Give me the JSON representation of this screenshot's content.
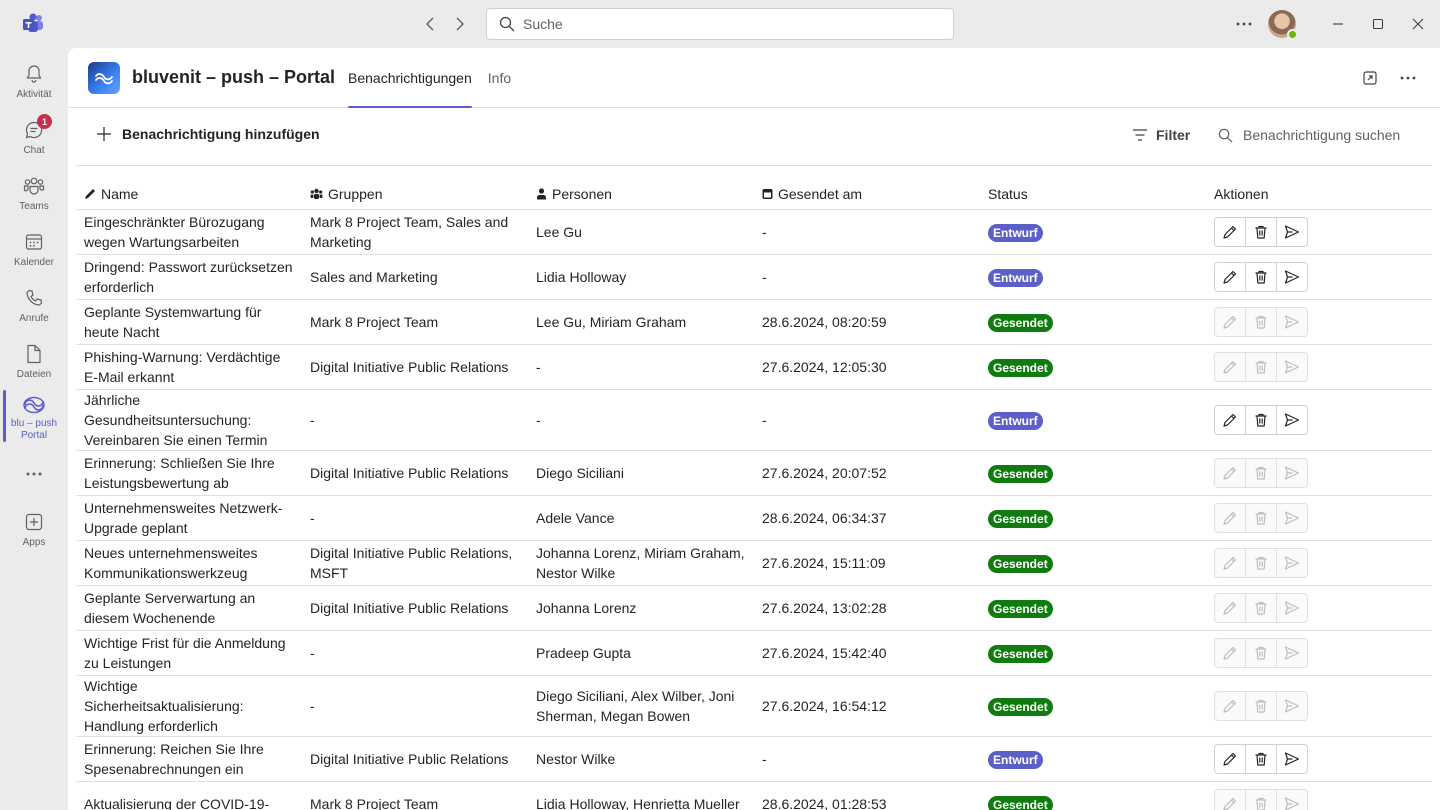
{
  "titlebar": {
    "search_placeholder": "Suche",
    "icons": [
      "teams-logo-icon",
      "back-arrow-icon",
      "forward-arrow-icon",
      "search-icon",
      "more-icon",
      "minimize-icon",
      "maximize-icon",
      "close-icon"
    ]
  },
  "rail": {
    "items": [
      {
        "label": "Aktivität",
        "icon": "bell-icon"
      },
      {
        "label": "Chat",
        "icon": "chat-icon",
        "badge": "1"
      },
      {
        "label": "Teams",
        "icon": "teams-icon"
      },
      {
        "label": "Kalender",
        "icon": "calendar-icon"
      },
      {
        "label": "Anrufe",
        "icon": "phone-icon"
      },
      {
        "label": "Dateien",
        "icon": "file-icon"
      },
      {
        "label": "blu – push Portal",
        "icon": "bluvenit-icon",
        "active": true
      },
      {
        "label": "Apps",
        "icon": "apps-icon"
      }
    ]
  },
  "app": {
    "title": "bluvenit – push – Portal",
    "tabs": [
      {
        "label": "Benachrichtigungen",
        "active": true
      },
      {
        "label": "Info",
        "active": false
      }
    ]
  },
  "toolbar": {
    "add_label": "Benachrichtigung hinzufügen",
    "filter_label": "Filter",
    "search_placeholder": "Benachrichtigung suchen"
  },
  "table": {
    "headers": {
      "name": "Name",
      "groups": "Gruppen",
      "persons": "Personen",
      "sent": "Gesendet am",
      "status": "Status",
      "actions": "Aktionen"
    },
    "rows": [
      {
        "name": "Eingeschränkter Bürozugang wegen Wartungsarbeiten",
        "groups": "Mark 8 Project Team, Sales and Marketing",
        "persons": "Lee Gu",
        "sent": "-",
        "status": "Entwurf"
      },
      {
        "name": "Dringend: Passwort zurücksetzen erforderlich",
        "groups": "Sales and Marketing",
        "persons": "Lidia Holloway",
        "sent": "-",
        "status": "Entwurf"
      },
      {
        "name": "Geplante Systemwartung für heute Nacht",
        "groups": "Mark 8 Project Team",
        "persons": "Lee Gu, Miriam Graham",
        "sent": "28.6.2024, 08:20:59",
        "status": "Gesendet"
      },
      {
        "name": "Phishing-Warnung: Verdächtige E-Mail erkannt",
        "groups": "Digital Initiative Public Relations",
        "persons": "-",
        "sent": "27.6.2024, 12:05:30",
        "status": "Gesendet"
      },
      {
        "name": "Jährliche Gesundheitsuntersuchung: Vereinbaren Sie einen Termin",
        "groups": "-",
        "persons": "-",
        "sent": "-",
        "status": "Entwurf"
      },
      {
        "name": "Erinnerung: Schließen Sie Ihre Leistungsbewertung ab",
        "groups": "Digital Initiative Public Relations",
        "persons": "Diego Siciliani",
        "sent": "27.6.2024, 20:07:52",
        "status": "Gesendet"
      },
      {
        "name": "Unternehmensweites Netzwerk-Upgrade geplant",
        "groups": "-",
        "persons": "Adele Vance",
        "sent": "28.6.2024, 06:34:37",
        "status": "Gesendet"
      },
      {
        "name": "Neues unternehmensweites Kommunikationswerkzeug",
        "groups": "Digital Initiative Public Relations, MSFT",
        "persons": "Johanna Lorenz, Miriam Graham, Nestor Wilke",
        "sent": "27.6.2024, 15:11:09",
        "status": "Gesendet"
      },
      {
        "name": "Geplante Serverwartung an diesem Wochenende",
        "groups": "Digital Initiative Public Relations",
        "persons": "Johanna Lorenz",
        "sent": "27.6.2024, 13:02:28",
        "status": "Gesendet"
      },
      {
        "name": "Wichtige Frist für die Anmeldung zu Leistungen",
        "groups": "-",
        "persons": "Pradeep Gupta",
        "sent": "27.6.2024, 15:42:40",
        "status": "Gesendet"
      },
      {
        "name": "Wichtige Sicherheitsaktualisierung: Handlung erforderlich",
        "groups": "-",
        "persons": "Diego Siciliani, Alex Wilber, Joni Sherman, Megan Bowen",
        "sent": "27.6.2024, 16:54:12",
        "status": "Gesendet"
      },
      {
        "name": "Erinnerung: Reichen Sie Ihre Spesenabrechnungen ein",
        "groups": "Digital Initiative Public Relations",
        "persons": "Nestor Wilke",
        "sent": "-",
        "status": "Entwurf"
      },
      {
        "name": "Aktualisierung der COVID-19-",
        "groups": "Mark 8 Project Team",
        "persons": "Lidia Holloway, Henrietta Mueller",
        "sent": "28.6.2024, 01:28:53",
        "status": "Gesendet"
      }
    ]
  },
  "colors": {
    "accent": "#5b5fc7",
    "sent": "#107c10",
    "draft": "#5b5fc7"
  }
}
